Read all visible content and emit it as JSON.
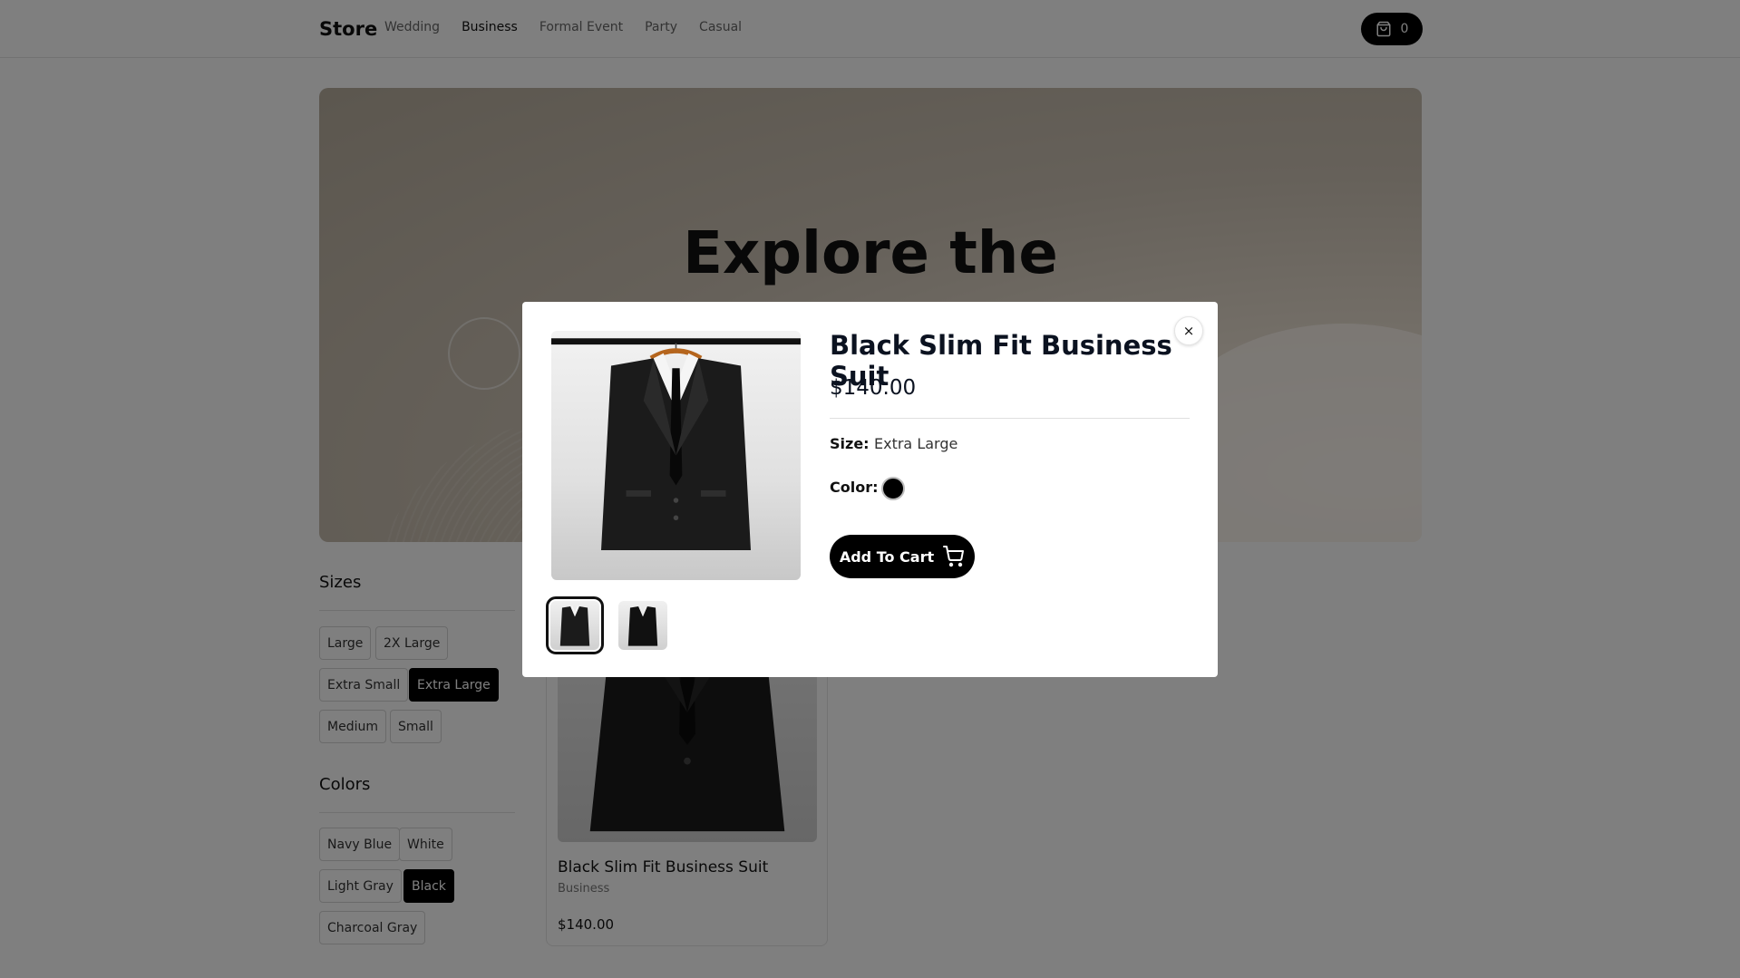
{
  "navbar": {
    "brand": "Store",
    "links": [
      "Wedding",
      "Business",
      "Formal Event",
      "Party",
      "Casual"
    ],
    "active_link": "Business",
    "cart_count": "0"
  },
  "hero": {
    "title": "Explore the"
  },
  "filters": {
    "sizes_title": "Sizes",
    "sizes": [
      "Large",
      "2X Large",
      "Extra Small",
      "Extra Large",
      "Medium",
      "Small"
    ],
    "selected_size": "Extra Large",
    "colors_title": "Colors",
    "colors": [
      "Navy Blue",
      "White",
      "Light Gray",
      "Black",
      "Charcoal Gray"
    ],
    "selected_color": "Black"
  },
  "product_card": {
    "name": "Black Slim Fit Business Suit",
    "category": "Business",
    "price": "$140.00"
  },
  "modal": {
    "title": "Black Slim Fit Business Suit",
    "price": "$140.00",
    "size_label": "Size:",
    "size_value": "Extra Large",
    "color_label": "Color:",
    "color_value": "#000000",
    "add_to_cart": "Add To Cart",
    "close_icon": "×"
  },
  "icons": {
    "cart": "shopping-bag-icon",
    "add_to_cart": "shopping-cart-icon",
    "close": "close-icon"
  },
  "colors": {
    "accent": "#000000",
    "overlay": "rgba(0,0,0,0.5)",
    "title": "#0b1220"
  }
}
